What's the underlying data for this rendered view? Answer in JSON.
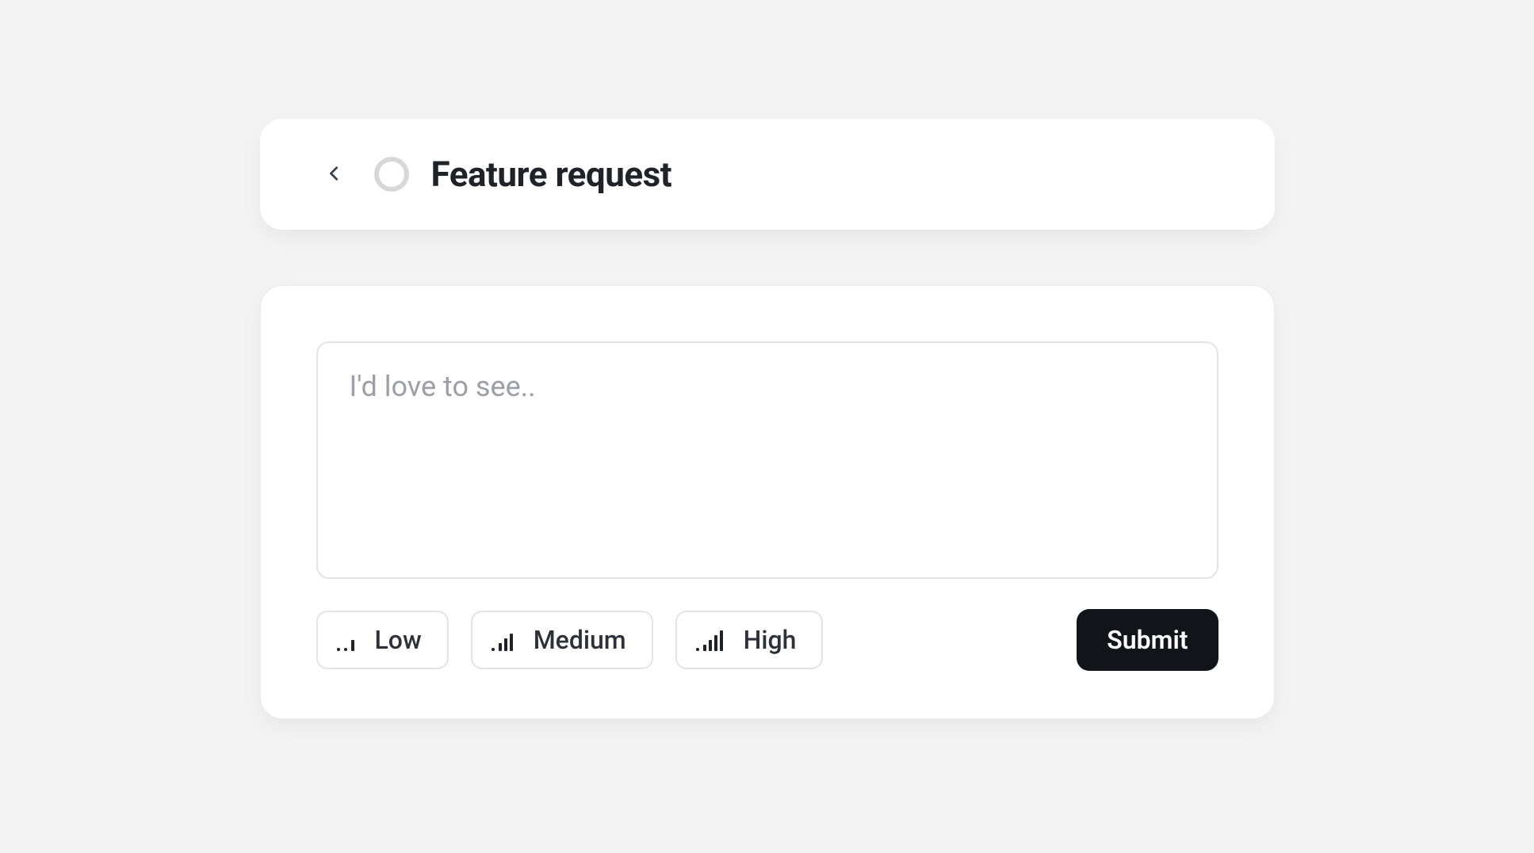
{
  "header": {
    "title": "Feature request"
  },
  "form": {
    "textarea_placeholder": "I'd love to see.."
  },
  "priority": {
    "low_label": "Low",
    "medium_label": "Medium",
    "high_label": "High"
  },
  "actions": {
    "submit_label": "Submit"
  }
}
